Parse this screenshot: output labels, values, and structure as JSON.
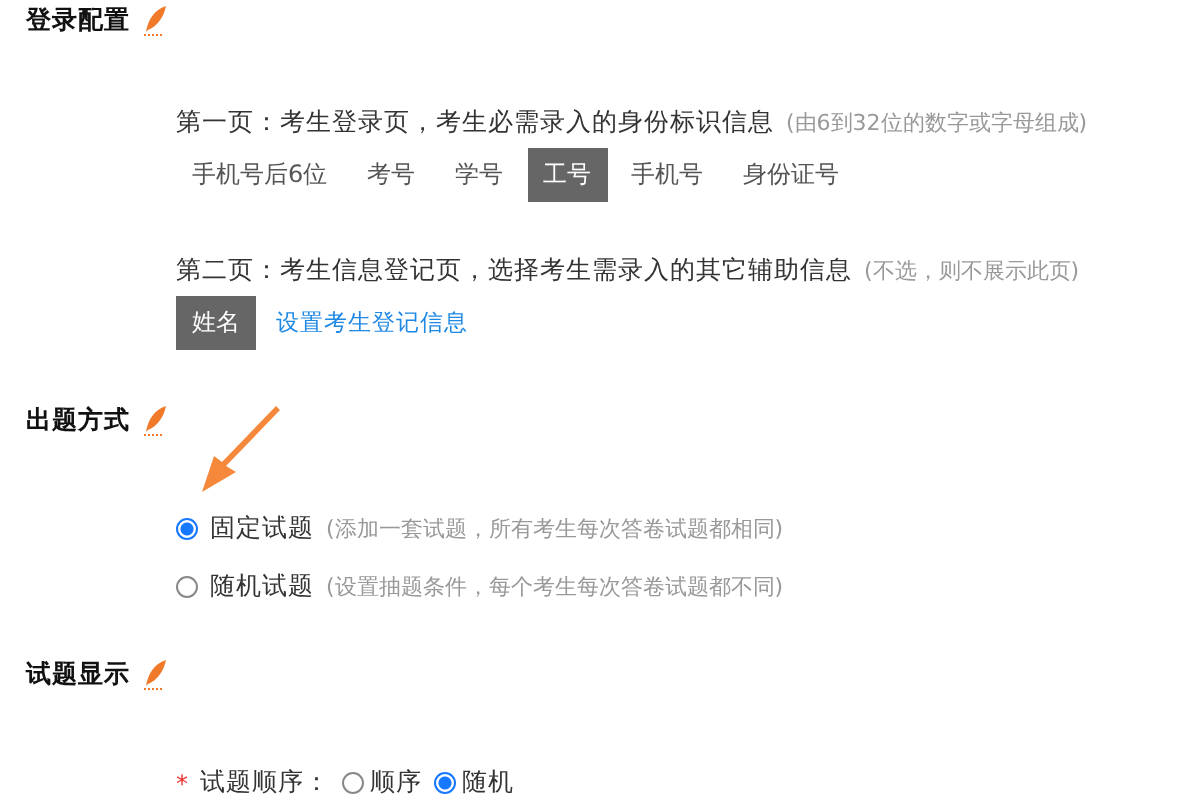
{
  "sections": [
    {
      "title": "登录配置",
      "blocks": [
        {
          "kind": "tags",
          "label": "第一页：考生登录页，考生必需录入的身份标识信息",
          "hint": "(由6到32位的数字或字母组成)",
          "tags": [
            {
              "label": "手机号后6位",
              "selected": false
            },
            {
              "label": "考号",
              "selected": false
            },
            {
              "label": "学号",
              "selected": false
            },
            {
              "label": "工号",
              "selected": true
            },
            {
              "label": "手机号",
              "selected": false
            },
            {
              "label": "身份证号",
              "selected": false
            }
          ]
        },
        {
          "kind": "tags",
          "label": "第二页：考生信息登记页，选择考生需录入的其它辅助信息",
          "hint": "(不选，则不展示此页)",
          "tags": [
            {
              "label": "姓名",
              "selected": true
            }
          ],
          "link": "设置考生登记信息"
        }
      ]
    },
    {
      "title": "出题方式",
      "blocks": [
        {
          "kind": "radios",
          "options": [
            {
              "label": "固定试题",
              "hint": "(添加一套试题，所有考生每次答卷试题都相同)",
              "selected": true
            },
            {
              "label": "随机试题",
              "hint": "(设置抽题条件，每个考生每次答卷试题都不同)",
              "selected": false
            }
          ]
        }
      ]
    },
    {
      "title": "试题显示",
      "blocks": [
        {
          "kind": "inline",
          "required": "*",
          "label": "试题顺序：",
          "options": [
            {
              "label": "顺序",
              "selected": false
            },
            {
              "label": "随机",
              "selected": true
            }
          ]
        }
      ]
    }
  ]
}
